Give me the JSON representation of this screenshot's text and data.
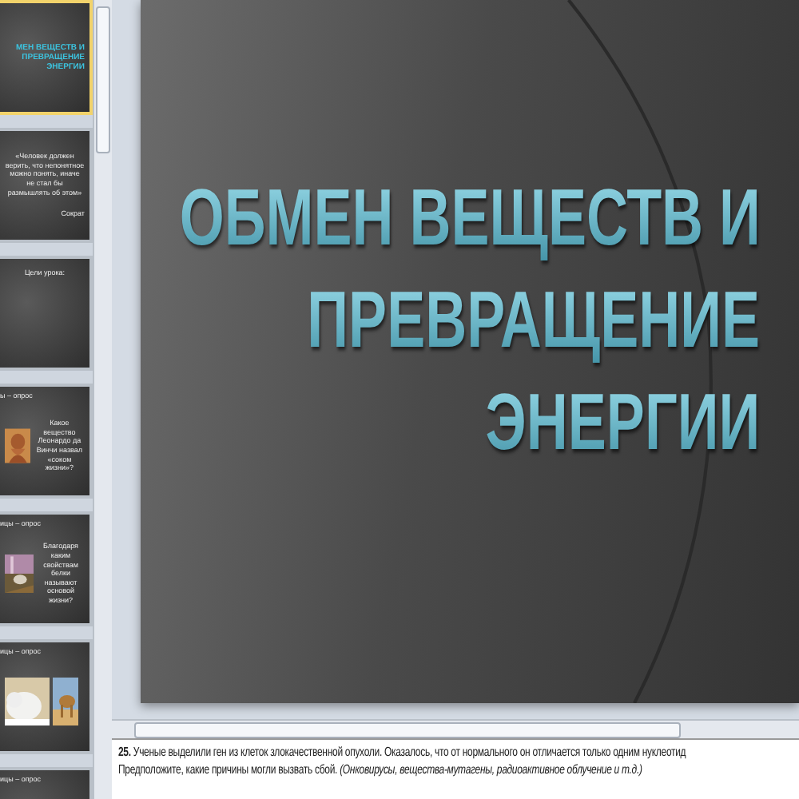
{
  "thumbnails": [
    {
      "kind": "title",
      "selected": true,
      "lines": [
        "МЕН ВЕЩЕСТВ И",
        "ПРЕВРАЩЕНИЕ",
        "ЭНЕРГИИ"
      ]
    },
    {
      "kind": "quote",
      "selected": false,
      "text": "«Человек должен верить, что непонятное можно понять, иначе не стал бы размышлять об этом»",
      "author": "Сократ"
    },
    {
      "kind": "heading",
      "selected": false,
      "heading": "Цели урока:"
    },
    {
      "kind": "question",
      "selected": false,
      "header": "ы – опрос",
      "text": "Какое вещество Леонардо да Винчи назвал «соком жизни»?"
    },
    {
      "kind": "question",
      "selected": false,
      "header": "ицы – опрос",
      "text": "Благодаря каким свойствам белки называют основой жизни?"
    },
    {
      "kind": "photos",
      "selected": false,
      "header": "ицы – опрос"
    },
    {
      "kind": "header",
      "selected": false,
      "header": "ицы – опрос"
    }
  ],
  "slide": {
    "title_lines": [
      "ОБМЕН ВЕЩЕСТВ И",
      "ПРЕВРАЩЕНИЕ",
      "ЭНЕРГИИ"
    ]
  },
  "notes": {
    "lines": [
      "**25.** Ученые выделили ген из клеток злокачественной опухоли. Оказалось, что от нормального он отличается только одним нуклеотид",
      "Предположите, какие причины могли вызвать сбой. *(Онковирусы, вещества-мутагены, радиоактивное облучение и т.д.)*"
    ]
  }
}
